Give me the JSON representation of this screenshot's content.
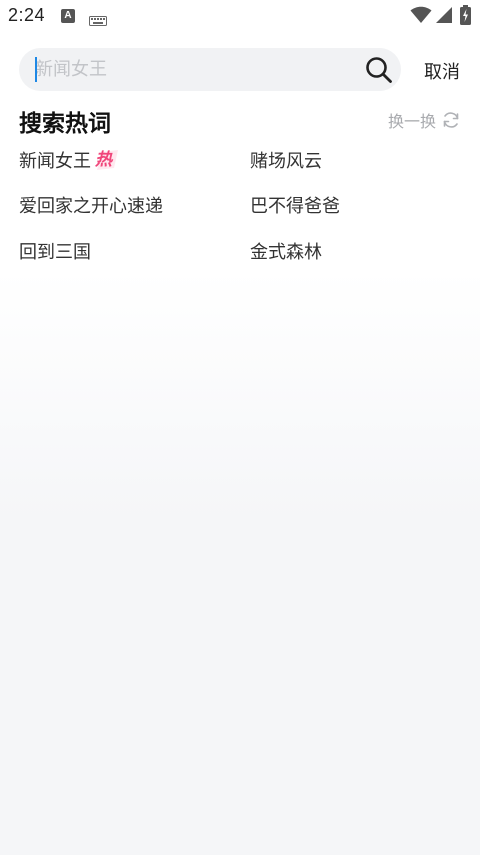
{
  "status_bar": {
    "time": "2:24",
    "a_icon_letter": "A"
  },
  "search": {
    "placeholder": "新闻女王",
    "value": ""
  },
  "cancel_label": "取消",
  "hot_section": {
    "title": "搜索热词",
    "refresh_label": "换一换",
    "hot_badge_text": "热",
    "items": [
      {
        "label": "新闻女王"
      },
      {
        "label": "赌场风云"
      },
      {
        "label": "爱回家之开心速递"
      },
      {
        "label": "巴不得爸爸"
      },
      {
        "label": "回到三国"
      },
      {
        "label": "金式森林"
      }
    ]
  },
  "colors": {
    "accent_caret": "#1e88e5",
    "hot_badge": "#f0457a",
    "muted_text": "#a8aaae"
  }
}
